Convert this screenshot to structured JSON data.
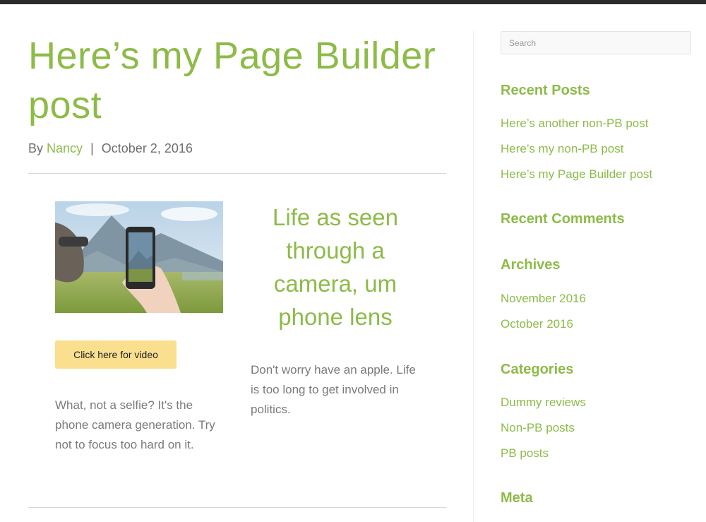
{
  "post": {
    "title": "Here’s my Page Builder post",
    "byline_prefix": "By",
    "author": "Nancy",
    "separator": "|",
    "date": "October 2, 2016"
  },
  "content": {
    "video_button_label": "Click here for video",
    "left_text": "What, not  a selfie? It's the phone camera generation. Try not to focus too hard on it.",
    "right_heading": "Life as seen through a camera, um phone lens",
    "right_text": "Don't worry have an apple. Life is too long to get involved in politics."
  },
  "sidebar": {
    "search_placeholder": "Search",
    "recent_posts": {
      "title": "Recent Posts",
      "items": [
        "Here’s another non-PB post",
        "Here’s my non-PB post",
        "Here’s my Page Builder post"
      ]
    },
    "recent_comments": {
      "title": "Recent Comments"
    },
    "archives": {
      "title": "Archives",
      "items": [
        "November 2016",
        "October 2016"
      ]
    },
    "categories": {
      "title": "Categories",
      "items": [
        "Dummy reviews",
        "Non-PB posts",
        "PB posts"
      ]
    },
    "meta": {
      "title": "Meta"
    }
  },
  "colors": {
    "accent_green": "#8dbb48",
    "button_yellow": "#f9df8e",
    "body_text": "#7a7a7a"
  }
}
